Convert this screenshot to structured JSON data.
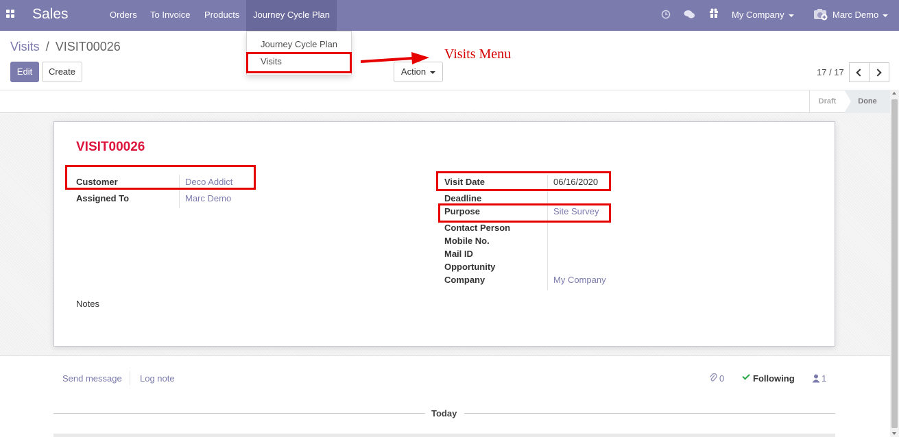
{
  "navbar": {
    "brand": "Sales",
    "menu": [
      "Orders",
      "To Invoice",
      "Products",
      "Journey Cycle Plan"
    ],
    "company": "My Company",
    "user": "Marc Demo"
  },
  "dropdown": {
    "items": [
      "Journey Cycle Plan",
      "Visits"
    ]
  },
  "breadcrumb": {
    "parent": "Visits",
    "separator": "/",
    "current": "VISIT00026"
  },
  "buttons": {
    "edit": "Edit",
    "create": "Create",
    "action": "Action"
  },
  "pager": {
    "text": "17 / 17"
  },
  "statusbar": {
    "draft": "Draft",
    "done": "Done"
  },
  "form": {
    "name": "VISIT00026",
    "left_fields": [
      {
        "label": "Customer",
        "value": "Deco Addict"
      },
      {
        "label": "Assigned To",
        "value": "Marc Demo"
      }
    ],
    "right_fields": [
      {
        "label": "Visit Date",
        "value": "06/16/2020"
      },
      {
        "label": "Deadline",
        "value": ""
      },
      {
        "label": "Purpose",
        "value": "Site Survey"
      },
      {
        "label": "Contact Person",
        "value": ""
      },
      {
        "label": "Mobile No.",
        "value": ""
      },
      {
        "label": "Mail ID",
        "value": ""
      },
      {
        "label": "Opportunity",
        "value": ""
      },
      {
        "label": "Company",
        "value": "My Company"
      }
    ],
    "notes_label": "Notes"
  },
  "annotation": {
    "text": "Visits Menu",
    "color": "#e60000"
  },
  "chatter": {
    "send_message": "Send message",
    "log_note": "Log note",
    "attachments": "0",
    "following": "Following",
    "followers": "1",
    "today": "Today"
  },
  "colors": {
    "primary": "#7c7bad",
    "record_name": "#dc143c"
  }
}
